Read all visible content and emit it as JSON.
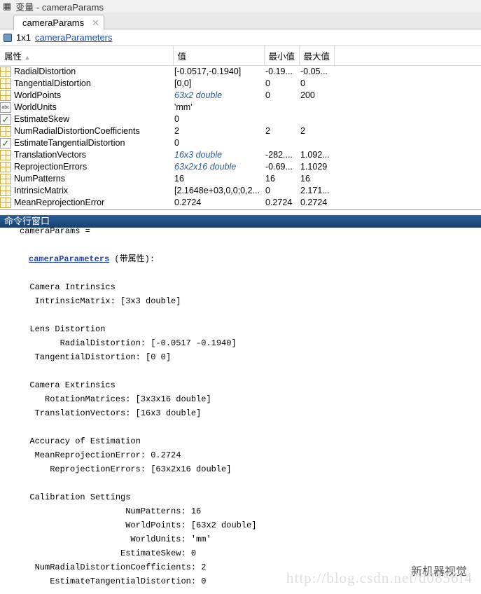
{
  "window": {
    "title": "变量 - cameraParams",
    "tab": "cameraParams"
  },
  "info": {
    "size": "1x1",
    "class": "cameraParameters"
  },
  "table": {
    "headers": [
      "属性",
      "值",
      "最小值",
      "最大值"
    ],
    "rows": [
      {
        "icon": "grid",
        "name": "RadialDistortion",
        "value": "[-0.0517,-0.1940]",
        "min": "-0.19...",
        "max": "-0.05...",
        "italic": false
      },
      {
        "icon": "grid",
        "name": "TangentialDistortion",
        "value": "[0,0]",
        "min": "0",
        "max": "0",
        "italic": false
      },
      {
        "icon": "grid",
        "name": "WorldPoints",
        "value": "63x2 double",
        "min": "0",
        "max": "200",
        "italic": true
      },
      {
        "icon": "abc",
        "name": "WorldUnits",
        "value": "'mm'",
        "min": "",
        "max": "",
        "italic": false
      },
      {
        "icon": "check",
        "name": "EstimateSkew",
        "value": "0",
        "min": "",
        "max": "",
        "italic": false
      },
      {
        "icon": "grid",
        "name": "NumRadialDistortionCoefficients",
        "value": "2",
        "min": "2",
        "max": "2",
        "italic": false
      },
      {
        "icon": "check",
        "name": "EstimateTangentialDistortion",
        "value": "0",
        "min": "",
        "max": "",
        "italic": false
      },
      {
        "icon": "grid",
        "name": "TranslationVectors",
        "value": "16x3 double",
        "min": "-282....",
        "max": "1.092...",
        "italic": true
      },
      {
        "icon": "grid",
        "name": "ReprojectionErrors",
        "value": "63x2x16 double",
        "min": "-0.69...",
        "max": "1.1029",
        "italic": true
      },
      {
        "icon": "grid",
        "name": "NumPatterns",
        "value": "16",
        "min": "16",
        "max": "16",
        "italic": false
      },
      {
        "icon": "grid",
        "name": "IntrinsicMatrix",
        "value": "[2.1648e+03,0,0;0,2...",
        "min": "0",
        "max": "2.171...",
        "italic": false
      },
      {
        "icon": "grid",
        "name": "MeanReprojectionError",
        "value": "0.2724",
        "min": "0.2724",
        "max": "0.2724",
        "italic": false
      }
    ]
  },
  "command": {
    "title": "命令行窗口",
    "lines": [
      {
        "row": 0,
        "text": "cameraParams ="
      },
      {
        "row": 2,
        "link": "cameraParameters",
        "text": " (带属性):"
      },
      {
        "row": 4,
        "text": "  Camera Intrinsics"
      },
      {
        "row": 5,
        "text": "   IntrinsicMatrix: [3x3 double]"
      },
      {
        "row": 7,
        "text": "  Lens Distortion"
      },
      {
        "row": 8,
        "text": "        RadialDistortion: [-0.0517 -0.1940]"
      },
      {
        "row": 9,
        "text": "   TangentialDistortion: [0 0]"
      },
      {
        "row": 11,
        "text": "  Camera Extrinsics"
      },
      {
        "row": 12,
        "text": "     RotationMatrices: [3x3x16 double]"
      },
      {
        "row": 13,
        "text": "   TranslationVectors: [16x3 double]"
      },
      {
        "row": 15,
        "text": "  Accuracy of Estimation"
      },
      {
        "row": 16,
        "text": "   MeanReprojectionError: 0.2724"
      },
      {
        "row": 17,
        "text": "      ReprojectionErrors: [63x2x16 double]"
      },
      {
        "row": 19,
        "text": "  Calibration Settings"
      },
      {
        "row": 20,
        "text": "                     NumPatterns: 16"
      },
      {
        "row": 21,
        "text": "                     WorldPoints: [63x2 double]"
      },
      {
        "row": 22,
        "text": "                      WorldUnits: 'mm'"
      },
      {
        "row": 23,
        "text": "                    EstimateSkew: 0"
      },
      {
        "row": 24,
        "text": "   NumRadialDistortionCoefficients: 2"
      },
      {
        "row": 25,
        "text": "      EstimateTangentialDistortion: 0"
      }
    ]
  },
  "watermark": {
    "url": "http://blog.csdn.net/d0856f4",
    "brand": "新机器视觉"
  }
}
